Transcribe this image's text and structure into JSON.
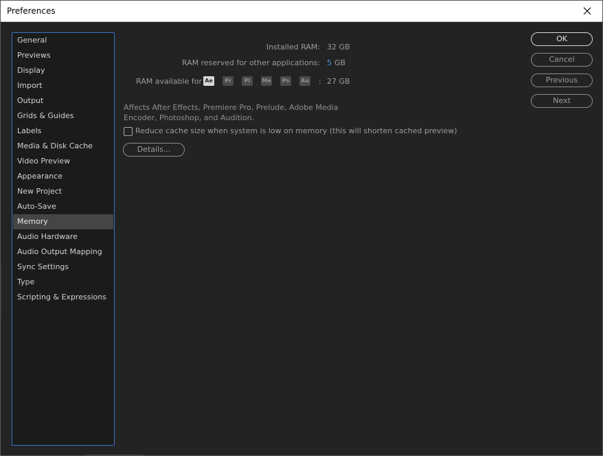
{
  "window": {
    "title": "Preferences"
  },
  "sidebar": {
    "items": [
      {
        "label": "General"
      },
      {
        "label": "Previews"
      },
      {
        "label": "Display"
      },
      {
        "label": "Import"
      },
      {
        "label": "Output"
      },
      {
        "label": "Grids & Guides"
      },
      {
        "label": "Labels"
      },
      {
        "label": "Media & Disk Cache"
      },
      {
        "label": "Video Preview"
      },
      {
        "label": "Appearance"
      },
      {
        "label": "New Project"
      },
      {
        "label": "Auto-Save"
      },
      {
        "label": "Memory"
      },
      {
        "label": "Audio Hardware"
      },
      {
        "label": "Audio Output Mapping"
      },
      {
        "label": "Sync Settings"
      },
      {
        "label": "Type"
      },
      {
        "label": "Scripting & Expressions"
      }
    ],
    "selected": "Memory"
  },
  "memory": {
    "installed_label": "Installed RAM:",
    "installed_value": "32 GB",
    "reserved_label": "RAM reserved for other applications:",
    "reserved_value": "5",
    "reserved_unit": "GB",
    "available_label": "RAM available for",
    "apps": [
      "Ae",
      "Pr",
      "Pl",
      "Me",
      "Ps",
      "Au"
    ],
    "available_sep": ":",
    "available_value": "27 GB",
    "description": "Affects After Effects, Premiere Pro, Prelude, Adobe Media Encoder, Photoshop, and Audition.",
    "reduce_cache_label": "Reduce cache size when system is low on memory (this will shorten cached preview)",
    "reduce_cache_checked": false,
    "details_label": "Details..."
  },
  "buttons": {
    "ok": "OK",
    "cancel": "Cancel",
    "previous": "Previous",
    "next": "Next"
  },
  "colors": {
    "background": "#232323",
    "sidebar_border": "#3a73c9",
    "link": "#4d8ee0"
  }
}
